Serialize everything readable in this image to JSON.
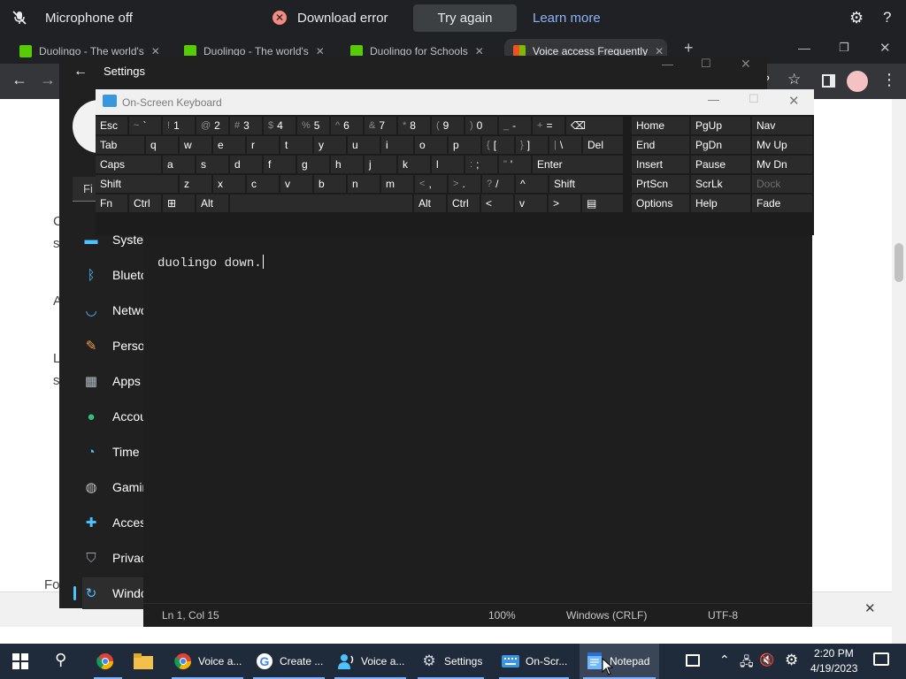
{
  "notification_bar": {
    "mic_status": "Microphone off",
    "error_text": "Download error",
    "try_again": "Try again",
    "learn_more": "Learn more"
  },
  "browser": {
    "tabs": [
      {
        "label": "Duolingo - The world's",
        "favicon_color": "#58cc02"
      },
      {
        "label": "Duolingo - The world's",
        "favicon_color": "#58cc02"
      },
      {
        "label": "Duolingo for Schools",
        "favicon_color": "#58cc02"
      },
      {
        "label": "Voice access Frequently",
        "favicon_color": "#f25022"
      }
    ],
    "page_fragments": [
      "C",
      "s",
      "A",
      "L",
      "s",
      "Fo"
    ]
  },
  "settings_window": {
    "title": "Settings",
    "search_fragment": "Fi",
    "nav_items": [
      {
        "label": "System",
        "icon": "monitor-icon",
        "color": "#4cc2ff"
      },
      {
        "label": "Bluetooth & devices",
        "icon": "bluetooth-icon",
        "color": "#4cc2ff"
      },
      {
        "label": "Network & internet",
        "icon": "wifi-icon",
        "color": "#4cc2ff"
      },
      {
        "label": "Personalization",
        "icon": "brush-icon",
        "color": "#f7a14a"
      },
      {
        "label": "Apps",
        "icon": "apps-icon",
        "color": "#b0bec5"
      },
      {
        "label": "Accounts",
        "icon": "person-icon",
        "color": "#2ec27e"
      },
      {
        "label": "Time & language",
        "icon": "clock-icon",
        "color": "#4cc2ff"
      },
      {
        "label": "Gaming",
        "icon": "gamepad-icon",
        "color": "#c0c0c0"
      },
      {
        "label": "Accessibility",
        "icon": "accessibility-icon",
        "color": "#4cc2ff"
      },
      {
        "label": "Privacy & security",
        "icon": "shield-icon",
        "color": "#9aa0a6"
      },
      {
        "label": "Windows Update",
        "icon": "update-icon",
        "color": "#4cc2ff"
      }
    ]
  },
  "osk": {
    "title": "On-Screen Keyboard",
    "rows": {
      "row1": [
        {
          "main": "Esc"
        },
        {
          "sub": "~",
          "main": "`"
        },
        {
          "sub": "!",
          "main": "1"
        },
        {
          "sub": "@",
          "main": "2"
        },
        {
          "sub": "#",
          "main": "3"
        },
        {
          "sub": "$",
          "main": "4"
        },
        {
          "sub": "%",
          "main": "5"
        },
        {
          "sub": "^",
          "main": "6"
        },
        {
          "sub": "&",
          "main": "7"
        },
        {
          "sub": "*",
          "main": "8"
        },
        {
          "sub": "(",
          "main": "9"
        },
        {
          "sub": ")",
          "main": "0"
        },
        {
          "sub": "_",
          "main": "-"
        },
        {
          "sub": "+",
          "main": "="
        },
        {
          "main": "⌫"
        }
      ],
      "row2": [
        {
          "main": "Tab"
        },
        {
          "main": "q"
        },
        {
          "main": "w"
        },
        {
          "main": "e"
        },
        {
          "main": "r"
        },
        {
          "main": "t"
        },
        {
          "main": "y"
        },
        {
          "main": "u"
        },
        {
          "main": "i"
        },
        {
          "main": "o"
        },
        {
          "main": "p"
        },
        {
          "sub": "{",
          "main": "["
        },
        {
          "sub": "}",
          "main": "]"
        },
        {
          "sub": "|",
          "main": "\\"
        },
        {
          "main": "Del"
        }
      ],
      "row3": [
        {
          "main": "Caps"
        },
        {
          "main": "a"
        },
        {
          "main": "s"
        },
        {
          "main": "d"
        },
        {
          "main": "f"
        },
        {
          "main": "g"
        },
        {
          "main": "h"
        },
        {
          "main": "j"
        },
        {
          "main": "k"
        },
        {
          "main": "l"
        },
        {
          "sub": ":",
          "main": ";"
        },
        {
          "sub": "\"",
          "main": "'"
        },
        {
          "main": "Enter"
        }
      ],
      "row4": [
        {
          "main": "Shift"
        },
        {
          "main": "z"
        },
        {
          "main": "x"
        },
        {
          "main": "c"
        },
        {
          "main": "v"
        },
        {
          "main": "b"
        },
        {
          "main": "n"
        },
        {
          "main": "m"
        },
        {
          "sub": "<",
          "main": ","
        },
        {
          "sub": ">",
          "main": "."
        },
        {
          "sub": "?",
          "main": "/"
        },
        {
          "main": "^"
        },
        {
          "main": "Shift"
        }
      ],
      "row5": [
        {
          "main": "Fn"
        },
        {
          "main": "Ctrl"
        },
        {
          "main": "⊞"
        },
        {
          "main": "Alt"
        },
        {
          "main": ""
        },
        {
          "main": "Alt"
        },
        {
          "main": "Ctrl"
        },
        {
          "main": "<"
        },
        {
          "main": "v"
        },
        {
          "main": ">"
        },
        {
          "main": "▤"
        }
      ]
    },
    "nav_keys": [
      [
        "Home",
        "PgUp",
        "Nav"
      ],
      [
        "End",
        "PgDn",
        "Mv Up"
      ],
      [
        "Insert",
        "Pause",
        "Mv Dn"
      ],
      [
        "PrtScn",
        "ScrLk",
        "Dock"
      ],
      [
        "Options",
        "Help",
        "Fade"
      ]
    ]
  },
  "notepad": {
    "content": "duolingo down.",
    "status_position": "Ln 1, Col 15",
    "status_zoom": "100%",
    "status_eol": "Windows (CRLF)",
    "status_encoding": "UTF-8"
  },
  "taskbar": {
    "apps": [
      {
        "label": "",
        "icon": "chrome-icon"
      },
      {
        "label": "",
        "icon": "file-explorer-icon"
      },
      {
        "label": "Voice a...",
        "icon": "chrome-profile-icon"
      },
      {
        "label": "Create ...",
        "icon": "google-icon"
      },
      {
        "label": "Voice a...",
        "icon": "voice-access-icon"
      },
      {
        "label": "Settings",
        "icon": "gear-icon"
      },
      {
        "label": "On-Scr...",
        "icon": "keyboard-icon"
      },
      {
        "label": "Notepad",
        "icon": "notepad-icon"
      }
    ],
    "time": "2:20 PM",
    "date": "4/19/2023"
  }
}
